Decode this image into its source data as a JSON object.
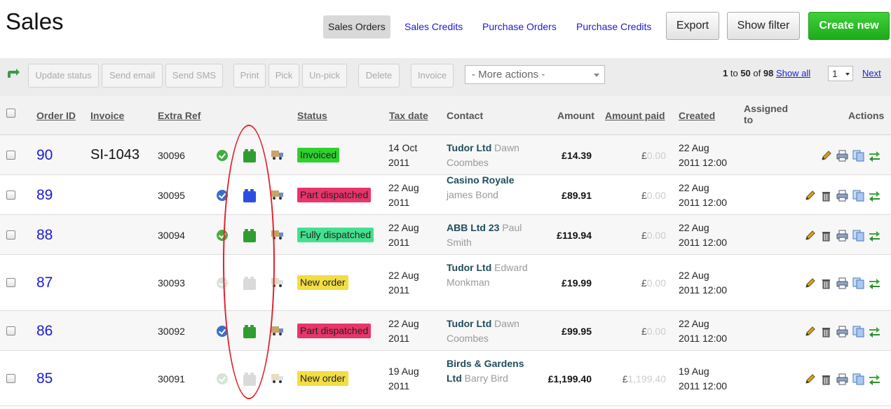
{
  "page": {
    "title": "Sales"
  },
  "nav": {
    "tabs": [
      {
        "label": "Sales Orders",
        "active": true
      },
      {
        "label": "Sales Credits",
        "active": false
      },
      {
        "label": "Purchase Orders",
        "active": false
      },
      {
        "label": "Purchase Credits",
        "active": false
      }
    ],
    "export_label": "Export",
    "show_filter_label": "Show filter",
    "create_new_label": "Create new"
  },
  "toolbar": {
    "buttons": [
      "Update status",
      "Send email",
      "Send SMS",
      "Print",
      "Pick",
      "Un-pick",
      "Delete",
      "Invoice"
    ],
    "more_actions": "- More actions -",
    "pagination": {
      "from": "1",
      "to_word": "to",
      "to": "50",
      "of_word": "of",
      "total": "98",
      "show_all": "Show all",
      "page": "1",
      "next": "Next"
    }
  },
  "table": {
    "headers": {
      "order_id": "Order ID",
      "invoice": "Invoice",
      "extra_ref": "Extra Ref",
      "status": "Status",
      "tax_date": "Tax date",
      "contact": "Contact",
      "amount": "Amount",
      "amount_paid": "Amount paid",
      "created": "Created",
      "assigned_l1": "Assigned",
      "assigned_l2": "to",
      "actions": "Actions"
    },
    "rows": [
      {
        "order_id": "90",
        "invoice": "SI-1043",
        "extra_ref": "30096",
        "status": "Invoiced",
        "status_color": "#2ed12e",
        "tax_date_l1": "14 Oct",
        "tax_date_l2": "2011",
        "contact_company": "Tudor Ltd",
        "contact_person": "Dawn Coombes",
        "amount": "£14.39",
        "paid_currency": "£",
        "paid_value": "0.00",
        "created_l1": "22 Aug",
        "created_l2": "2011 12:00",
        "payment_icon": "green-check-icon",
        "stock_icon": "green-cube-icon",
        "shipping_icon": "truck-icon"
      },
      {
        "order_id": "89",
        "invoice": "",
        "extra_ref": "30095",
        "status": "Part dispatched",
        "status_color": "#e8356a",
        "tax_date_l1": "22 Aug",
        "tax_date_l2": "2011",
        "contact_company": "Casino Royale",
        "contact_person": "james Bond",
        "amount": "£89.91",
        "paid_currency": "£",
        "paid_value": "0.00",
        "created_l1": "22 Aug",
        "created_l2": "2011 12:00",
        "payment_icon": "blue-check-icon",
        "stock_icon": "blue-cube-icon",
        "shipping_icon": "truck-icon"
      },
      {
        "order_id": "88",
        "invoice": "",
        "extra_ref": "30094",
        "status": "Fully dispatched",
        "status_color": "#45e08e",
        "tax_date_l1": "22 Aug",
        "tax_date_l2": "2011",
        "contact_company": "ABB Ltd 23",
        "contact_person": "Paul Smith",
        "amount": "£119.94",
        "paid_currency": "£",
        "paid_value": "0.00",
        "created_l1": "22 Aug",
        "created_l2": "2011 12:00",
        "payment_icon": "orange-check-icon",
        "stock_icon": "green-cube-icon",
        "shipping_icon": "truck-icon"
      },
      {
        "order_id": "87",
        "invoice": "",
        "extra_ref": "30093",
        "status": "New order",
        "status_color": "#f2dd45",
        "tax_date_l1": "22 Aug",
        "tax_date_l2": "2011",
        "contact_company": "Tudor Ltd",
        "contact_person": "Edward Monkman",
        "amount": "£19.99",
        "paid_currency": "£",
        "paid_value": "0.00",
        "created_l1": "22 Aug",
        "created_l2": "2011 12:00",
        "payment_icon": "grey-check-icon",
        "stock_icon": "grey-cube-icon",
        "shipping_icon": "grey-truck-icon"
      },
      {
        "order_id": "86",
        "invoice": "",
        "extra_ref": "30092",
        "status": "Part dispatched",
        "status_color": "#e8356a",
        "tax_date_l1": "22 Aug",
        "tax_date_l2": "2011",
        "contact_company": "Tudor Ltd",
        "contact_person": "Dawn Coombes",
        "amount": "£99.95",
        "paid_currency": "£",
        "paid_value": "0.00",
        "created_l1": "22 Aug",
        "created_l2": "2011 12:00",
        "payment_icon": "blue-check-icon",
        "stock_icon": "green-cube-icon",
        "shipping_icon": "truck-icon"
      },
      {
        "order_id": "85",
        "invoice": "",
        "extra_ref": "30091",
        "status": "New order",
        "status_color": "#f2dd45",
        "tax_date_l1": "19 Aug",
        "tax_date_l2": "2011",
        "contact_company": "Birds & Gardens Ltd",
        "contact_person": "Barry Bird",
        "amount": "£1,199.40",
        "paid_currency": "£",
        "paid_value": "1,199.40",
        "created_l1": "19 Aug",
        "created_l2": "2011 12:00",
        "payment_icon": "grey-check-icon",
        "stock_icon": "grey-cube-icon",
        "shipping_icon": "grey-truck-icon"
      }
    ]
  },
  "colors": {
    "link": "#1a1ad6",
    "create_button": "#23b820",
    "annotation": "#e0202a"
  }
}
